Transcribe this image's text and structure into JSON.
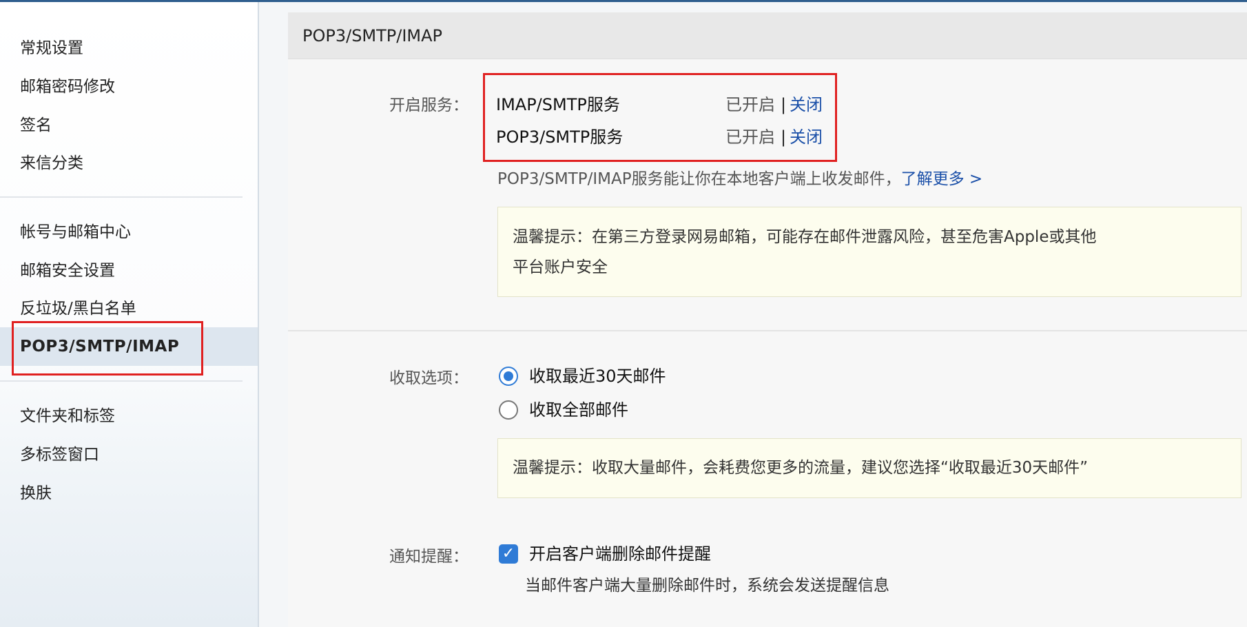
{
  "sidebar": {
    "group1": [
      "常规设置",
      "邮箱密码修改",
      "签名",
      "来信分类"
    ],
    "group2": [
      "帐号与邮箱中心",
      "邮箱安全设置",
      "反垃圾/黑白名单",
      "POP3/SMTP/IMAP"
    ],
    "group3": [
      "文件夹和标签",
      "多标签窗口",
      "换肤"
    ],
    "active": "POP3/SMTP/IMAP"
  },
  "main": {
    "title": "POP3/SMTP/IMAP",
    "services": {
      "label": "开启服务：",
      "items": [
        {
          "name": "IMAP/SMTP服务",
          "status": "已开启",
          "sep": "|",
          "action": "关闭"
        },
        {
          "name": "POP3/SMTP服务",
          "status": "已开启",
          "sep": "|",
          "action": "关闭"
        }
      ],
      "desc": "POP3/SMTP/IMAP服务能让你在本地客户端上收发邮件，",
      "learn_more": "了解更多 >",
      "tip_line1": "温馨提示：在第三方登录网易邮箱，可能存在邮件泄露风险，甚至危害Apple或其他",
      "tip_line2": "平台账户安全"
    },
    "receive": {
      "label": "收取选项：",
      "options": [
        "收取最近30天邮件",
        "收取全部邮件"
      ],
      "selected": "收取最近30天邮件",
      "tip": "温馨提示：收取大量邮件，会耗费您更多的流量，建议您选择“收取最近30天邮件”"
    },
    "notify": {
      "label": "通知提醒：",
      "checkbox_label": "开启客户端删除邮件提醒",
      "checked": true,
      "sub": "当邮件客户端大量删除邮件时，系统会发送提醒信息"
    }
  },
  "colors": {
    "accent": "#2f7bd6",
    "link": "#1a4fa8",
    "highlight_box": "#e02020",
    "tip_bg": "#fdfdee"
  }
}
